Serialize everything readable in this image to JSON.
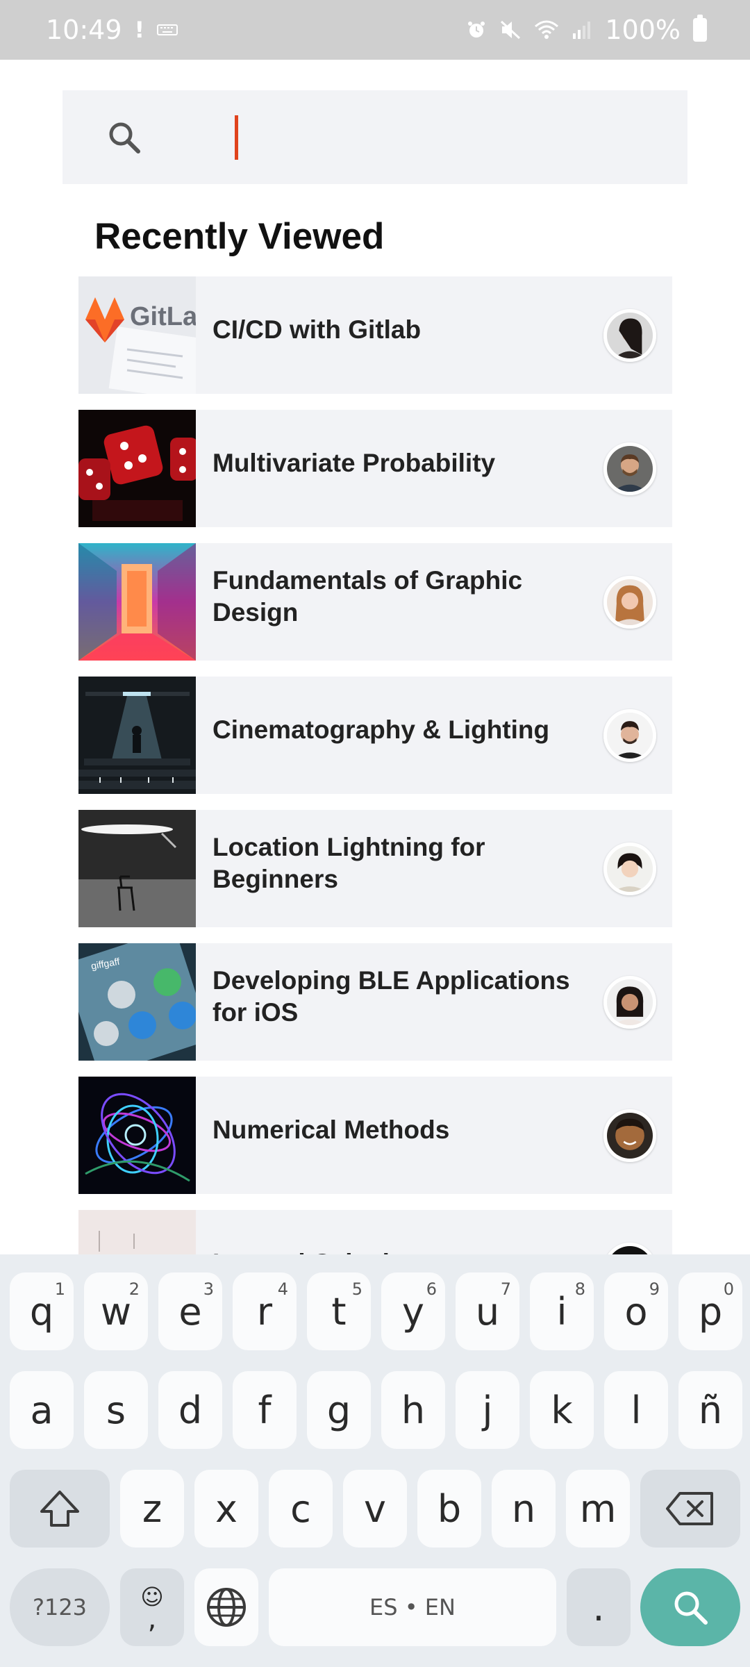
{
  "status_bar": {
    "time": "10:49",
    "alert_glyph": "!",
    "battery": "100%",
    "icons": [
      "keyboard-icon",
      "alarm-icon",
      "mute-icon",
      "wifi-icon",
      "signal-icon",
      "battery-icon"
    ]
  },
  "search": {
    "placeholder": "",
    "value": ""
  },
  "section_title": "Recently Viewed",
  "courses": [
    {
      "title": "CI/CD with Gitlab",
      "thumb": "gitlab"
    },
    {
      "title": "Multivariate Probability",
      "thumb": "dice"
    },
    {
      "title": "Fundamentals of Graphic Design",
      "thumb": "neon-corridor"
    },
    {
      "title": "Cinematography & Lighting",
      "thumb": "stage"
    },
    {
      "title": "Location Lightning for Beginners",
      "thumb": "studio-chair"
    },
    {
      "title": "Developing BLE Applications for iOS",
      "thumb": "phone"
    },
    {
      "title": "Numerical Methods",
      "thumb": "light-swirl"
    },
    {
      "title": "Integral Calculus",
      "thumb": "sketch"
    }
  ],
  "keyboard": {
    "row1": [
      {
        "k": "q",
        "h": "1"
      },
      {
        "k": "w",
        "h": "2"
      },
      {
        "k": "e",
        "h": "3"
      },
      {
        "k": "r",
        "h": "4"
      },
      {
        "k": "t",
        "h": "5"
      },
      {
        "k": "y",
        "h": "6"
      },
      {
        "k": "u",
        "h": "7"
      },
      {
        "k": "i",
        "h": "8"
      },
      {
        "k": "o",
        "h": "9"
      },
      {
        "k": "p",
        "h": "0"
      }
    ],
    "row2": [
      "a",
      "s",
      "d",
      "f",
      "g",
      "h",
      "j",
      "k",
      "l",
      "ñ"
    ],
    "row3": [
      "z",
      "x",
      "c",
      "v",
      "b",
      "n",
      "m"
    ],
    "symbols_label": "?123",
    "comma_label": ",",
    "emoji_label": "☺",
    "space_label": "ES • EN",
    "period_label": ".",
    "accent_color": "#5bb5a8"
  },
  "colors": {
    "caret": "#e0431d",
    "card_bg": "#f2f3f6"
  }
}
